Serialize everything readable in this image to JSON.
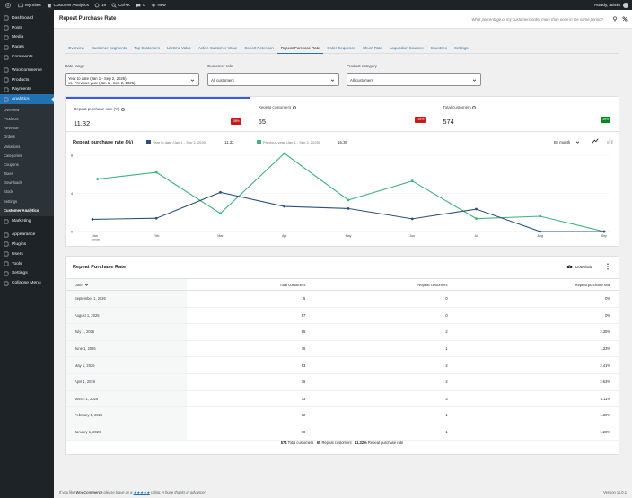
{
  "adminbar": {
    "my_sites": "My Sites",
    "site_name": "Customer Analytics",
    "updates": "19",
    "search": "Ctrl+K",
    "comments": "0",
    "new": "New",
    "howdy": "Howdy, admin"
  },
  "sidebar": {
    "items": [
      {
        "label": "Dashboard",
        "icon": "dashboard-icon"
      },
      {
        "label": "Posts",
        "icon": "pin-icon"
      },
      {
        "label": "Media",
        "icon": "media-icon"
      },
      {
        "label": "Pages",
        "icon": "page-icon"
      },
      {
        "label": "Comments",
        "icon": "comment-icon"
      },
      {
        "label": "WooCommerce",
        "icon": "woo-icon"
      },
      {
        "label": "Products",
        "icon": "box-icon"
      },
      {
        "label": "Payments",
        "icon": "payments-icon"
      },
      {
        "label": "Analytics",
        "icon": "chart-icon"
      }
    ],
    "submenu": [
      "Overview",
      "Products",
      "Revenue",
      "Orders",
      "Variations",
      "Categories",
      "Coupons",
      "Taxes",
      "Downloads",
      "Stock",
      "Settings",
      "Customer Analytics"
    ],
    "items_after": [
      {
        "label": "Marketing",
        "icon": "megaphone-icon"
      },
      {
        "label": "Appearance",
        "icon": "brush-icon"
      },
      {
        "label": "Plugins",
        "icon": "plug-icon"
      },
      {
        "label": "Users",
        "icon": "user-icon"
      },
      {
        "label": "Tools",
        "icon": "wrench-icon"
      },
      {
        "label": "Settings",
        "icon": "settings-icon"
      },
      {
        "label": "Collapse Menu",
        "icon": "collapse-icon"
      }
    ]
  },
  "header": {
    "title": "Repeat Purchase Rate",
    "hint": "What percentage of my customers order more than once in the same period?"
  },
  "tabs": [
    "Overview",
    "Customer Segments",
    "Top Customers",
    "Lifetime Value",
    "Active Customer Value",
    "Cohort Retention",
    "Repeat Purchase Rate",
    "Order Sequence",
    "Churn Rate",
    "Acquisition Sources",
    "Countries",
    "Settings"
  ],
  "filters": {
    "date_range": {
      "label": "Date range",
      "line1": "Year to date (Jan 1 - Sep 2, 2026)",
      "line2": "vs. Previous year (Jan 1 - Sep 2, 2025)"
    },
    "customer_role": {
      "label": "Customer role",
      "value": "All customers"
    },
    "product_category": {
      "label": "Product category",
      "value": "All customers"
    }
  },
  "summary": [
    {
      "label": "Repeat purchase rate (%)",
      "value": "11.32",
      "delta": "-38%",
      "trend": "neg"
    },
    {
      "label": "Repeat customers",
      "value": "65",
      "delta": "-34%",
      "trend": "neg"
    },
    {
      "label": "Total customers",
      "value": "574",
      "delta": "39%",
      "trend": "pos"
    }
  ],
  "chart": {
    "title": "Repeat purchase rate (%)",
    "legend_current": "Year to date (Jan 1 - Sep 2, 2026)",
    "legend_current_value": "11.32",
    "legend_previous": "Previous year (Jan 1 - Sep 2, 2025)",
    "legend_previous_value": "16.36",
    "interval": "By month"
  },
  "chart_data": {
    "type": "line",
    "categories": [
      "Jan 2026",
      "Feb",
      "Mar",
      "Apr",
      "May",
      "Jun",
      "Jul",
      "Aug",
      "Sep"
    ],
    "tick_labels": [
      "Jan",
      "Feb",
      "Mar",
      "Apr",
      "May",
      "Jun",
      "Jul",
      "Aug",
      "Sep"
    ],
    "first_tick_year": "2026",
    "ylim": [
      0,
      8
    ],
    "yticks": [
      0,
      4,
      8
    ],
    "series": [
      {
        "name": "Year to date (Jan 1 - Sep 2, 2026)",
        "color": "#2b5178",
        "x": [
          0,
          1,
          2,
          3,
          4,
          5,
          6,
          7,
          8
        ],
        "values": [
          1.28,
          1.39,
          4.11,
          2.63,
          2.41,
          1.33,
          2.35,
          0,
          0
        ]
      },
      {
        "name": "Previous year (Jan 1 - Sep 2, 2025)",
        "color": "#3fb27f",
        "x": [
          0.08,
          1,
          2,
          3,
          4,
          5,
          6,
          7,
          8
        ],
        "values": [
          5.5,
          6.2,
          1.9,
          8.2,
          3.3,
          5.3,
          1.35,
          1.6,
          0
        ]
      }
    ]
  },
  "table": {
    "title": "Repeat Purchase Rate",
    "download": "Download",
    "columns": [
      "Date",
      "Total customers",
      "Repeat customers",
      "Repeat purchase rate"
    ],
    "rows": [
      [
        "September 1, 2026",
        "5",
        "0",
        "0%"
      ],
      [
        "August 1, 2026",
        "87",
        "0",
        "0%"
      ],
      [
        "July 1, 2026",
        "85",
        "2",
        "2.35%"
      ],
      [
        "June 1, 2026",
        "75",
        "1",
        "1.33%"
      ],
      [
        "May 1, 2026",
        "83",
        "2",
        "2.41%"
      ],
      [
        "April 1, 2026",
        "76",
        "2",
        "2.63%"
      ],
      [
        "March 1, 2026",
        "73",
        "3",
        "4.11%"
      ],
      [
        "February 1, 2026",
        "72",
        "1",
        "1.39%"
      ],
      [
        "January 1, 2026",
        "78",
        "1",
        "1.28%"
      ]
    ],
    "footer": {
      "total_customers": "574",
      "total_label": "Total customers",
      "repeat_customers": "65",
      "repeat_label": "Repeat customers",
      "rate": "11.32%",
      "rate_label": "Repeat purchase rate"
    }
  },
  "footer": {
    "pre": "If you like ",
    "brand": "WooCommerce",
    "mid": " please leave us a ",
    "stars": "★★★★★",
    "post": " rating. A huge thanks in advance!",
    "version": "Version 11.0.1"
  }
}
